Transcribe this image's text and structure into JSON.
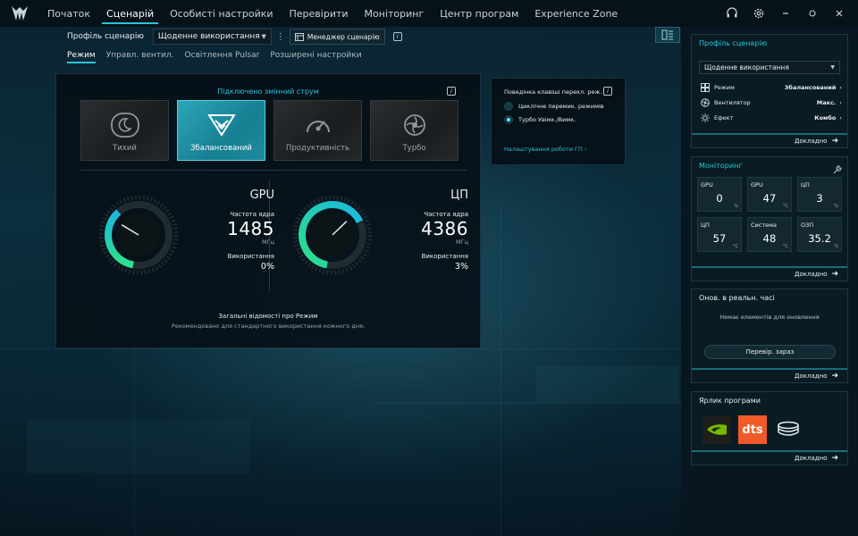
{
  "nav": {
    "items": [
      {
        "label": "Початок",
        "active": false
      },
      {
        "label": "Сценарій",
        "active": true
      },
      {
        "label": "Особисті настройки",
        "active": false
      },
      {
        "label": "Перевірити",
        "active": false
      },
      {
        "label": "Моніторинг",
        "active": false
      },
      {
        "label": "Центр програм",
        "active": false
      },
      {
        "label": "Experience Zone",
        "active": false
      }
    ],
    "icons": [
      "headset-icon",
      "gear-icon",
      "minimize-icon",
      "restore-icon",
      "close-icon"
    ]
  },
  "profile": {
    "label": "Профіль сценарію",
    "selected": "Щоденне використання",
    "manager_label": "Менеджер сценарію"
  },
  "subtabs": [
    "Режим",
    "Управл. вентил.",
    "Освітлення Pulsar",
    "Розширені настройки"
  ],
  "main": {
    "power_status": "Підключено змінний струм",
    "modes": [
      {
        "label": "Тихий",
        "icon": "moon-icon",
        "active": false
      },
      {
        "label": "Збалансований",
        "icon": "balance-icon",
        "active": true
      },
      {
        "label": "Продуктивність",
        "icon": "speedometer-icon",
        "active": false
      },
      {
        "label": "Турбо",
        "icon": "turbo-fan-icon",
        "active": false
      }
    ],
    "gpu": {
      "title": "GPU",
      "freq_label": "Частота ядра",
      "freq": "1485",
      "unit": "МГц",
      "use_label": "Використання",
      "use": "0%",
      "gauge_fraction": 0.43
    },
    "cpu": {
      "title": "ЦП",
      "freq_label": "Частота ядра",
      "freq": "4386",
      "unit": "МГц",
      "use_label": "Використання",
      "use": "3%",
      "gauge_fraction": 0.78
    },
    "summary_title": "Загальні відомості про Режим",
    "summary_desc": "Рекомендовано для стандартного використання кожного дня."
  },
  "key_panel": {
    "title": "Поведінка клавіші перекл. реж.",
    "options": [
      {
        "label": "Циклічне перемик. режимів",
        "selected": false
      },
      {
        "label": "Турбо Увімк./Вимк.",
        "selected": true
      }
    ],
    "link": "Налаштування роботи ГП ›"
  },
  "sidebar": {
    "details_label": "Докладно",
    "profile_card": {
      "title": "Профіль сценарію",
      "selected": "Щоденне використання",
      "rows": [
        {
          "icon": "mode-grid-icon",
          "label": "Режим",
          "value": "Збалансований"
        },
        {
          "icon": "fan-icon",
          "label": "Вентилятор",
          "value": "Макс."
        },
        {
          "icon": "sun-icon",
          "label": "Ефект",
          "value": "Комбо"
        }
      ]
    },
    "monitor_card": {
      "title": "Моніторинг",
      "cells": [
        {
          "label": "GPU",
          "value": "0",
          "unit": "%"
        },
        {
          "label": "GPU",
          "value": "47",
          "unit": "°C"
        },
        {
          "label": "ЦП",
          "value": "3",
          "unit": "%"
        },
        {
          "label": "ЦП",
          "value": "57",
          "unit": "°C"
        },
        {
          "label": "Система",
          "value": "48",
          "unit": "°C"
        },
        {
          "label": "ОЗП",
          "value": "35.2",
          "unit": "%"
        }
      ]
    },
    "realtime_card": {
      "title": "Онов. в реальн. часі",
      "empty": "Немає елементів для оновлення",
      "check_button": "Перевір. зараз"
    },
    "shortcut_card": {
      "title": "Ярлик програми",
      "apps": [
        "nvidia-icon",
        "dts-icon",
        "disk-stack-icon"
      ],
      "dts_text": "dts"
    }
  },
  "colors": {
    "accent": "#28c4d8",
    "active_mode": "#1d8b9d",
    "gauge_start": "#19b8e0",
    "gauge_end": "#2de08a"
  }
}
